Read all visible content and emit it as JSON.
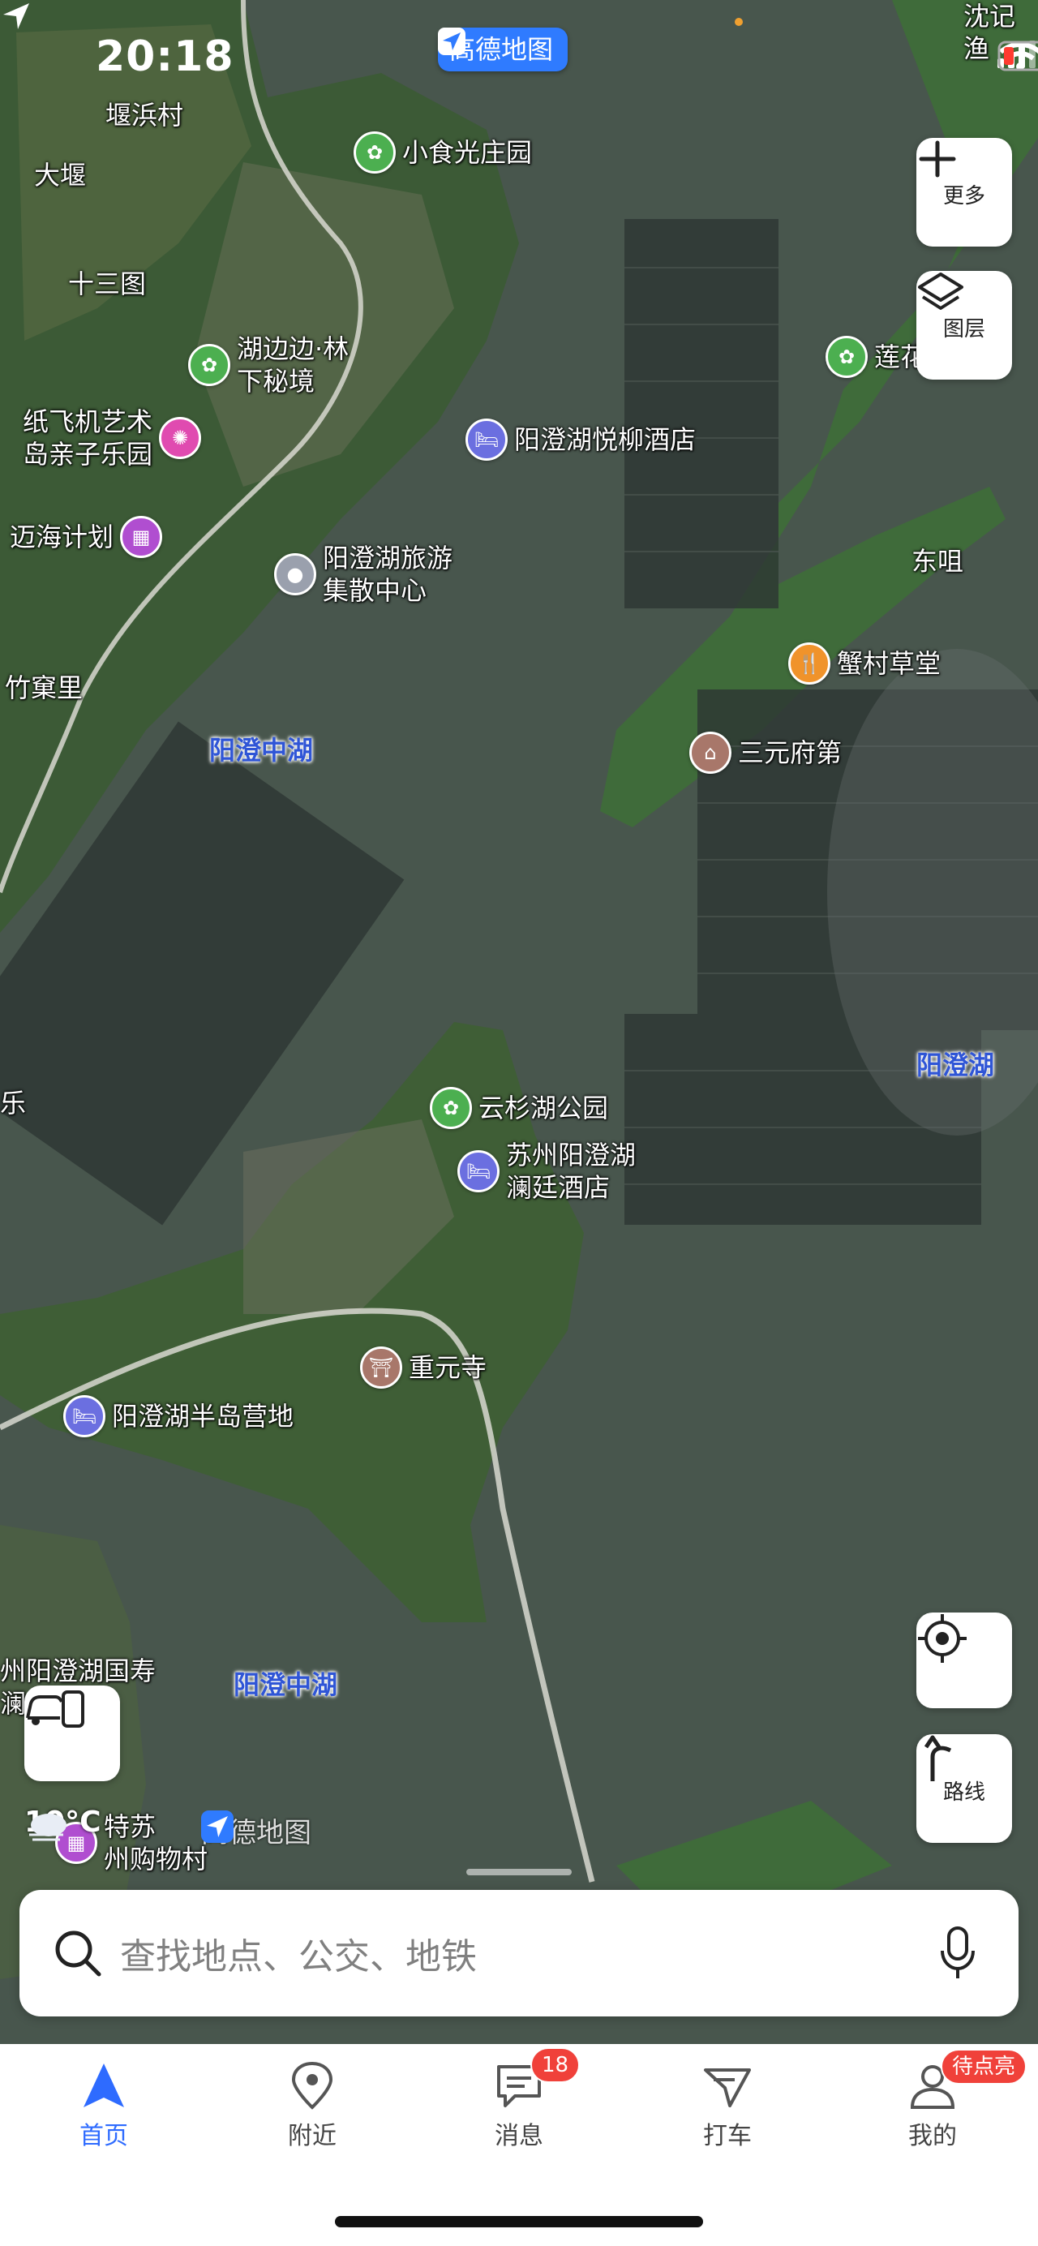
{
  "status": {
    "time": "20:18"
  },
  "brand": {
    "name": "高德地图"
  },
  "map": {
    "places": [
      "堰浜村",
      "大堰",
      "十三图",
      "竹窠里",
      "东咀",
      "沈记渔",
      "乐"
    ],
    "lakes": [
      "阳澄中湖",
      "阳澄湖",
      "阳澄中湖"
    ],
    "pois": [
      {
        "label": "小食光庄园",
        "icon": "park-icon",
        "color": "#4caf50"
      },
      {
        "label": "湖边边·林\n下秘境",
        "icon": "park-icon",
        "color": "#4caf50"
      },
      {
        "label": "阳澄湖悦柳酒店",
        "icon": "hotel-icon",
        "color": "#6b6fe0"
      },
      {
        "label": "纸飞机艺术\n岛亲子乐园",
        "icon": "amusement-icon",
        "color": "#e04bb0"
      },
      {
        "label": "迈海计划",
        "icon": "shop-icon",
        "color": "#b04ed0"
      },
      {
        "label": "阳澄湖旅游\n集散中心",
        "icon": "transit-icon",
        "color": "#9aa0ad"
      },
      {
        "label": "竹窠里",
        "icon": "",
        "color": ""
      },
      {
        "label": "莲花",
        "icon": "park-icon",
        "color": "#4caf50"
      },
      {
        "label": "蟹村草堂",
        "icon": "restaurant-icon",
        "color": "#f0932b"
      },
      {
        "label": "三元府第",
        "icon": "landmark-icon",
        "color": "#a8776a"
      },
      {
        "label": "云杉湖公园",
        "icon": "park-icon",
        "color": "#4caf50"
      },
      {
        "label": "苏州阳澄湖\n澜廷酒店",
        "icon": "hotel-icon",
        "color": "#6b6fe0"
      },
      {
        "label": "重元寺",
        "icon": "temple-icon",
        "color": "#a8776a"
      },
      {
        "label": "阳澄湖半岛营地",
        "icon": "hotel-icon",
        "color": "#6b6fe0"
      },
      {
        "label": "州阳澄湖国寿\n澜",
        "icon": "",
        "color": ""
      },
      {
        "label": "特苏\n州购物村",
        "icon": "shop-icon",
        "color": "#b04ed0"
      }
    ]
  },
  "controls": {
    "more_label": "更多",
    "layers_label": "图层",
    "route_label": "路线"
  },
  "weather": {
    "temp": "10°C"
  },
  "search": {
    "placeholder": "查找地点、公交、地铁"
  },
  "nav": {
    "items": [
      {
        "label": "首页",
        "icon": "navigation-arrow-icon"
      },
      {
        "label": "附近",
        "icon": "location-pin-icon"
      },
      {
        "label": "消息",
        "icon": "message-icon"
      },
      {
        "label": "打车",
        "icon": "taxi-icon"
      },
      {
        "label": "我的",
        "icon": "profile-icon"
      }
    ],
    "message_badge": "18",
    "profile_badge": "待点亮"
  },
  "colors": {
    "accent": "#2e6bff",
    "badge": "#f0413a",
    "water": "#44524a",
    "land": "#3f6b3a"
  }
}
